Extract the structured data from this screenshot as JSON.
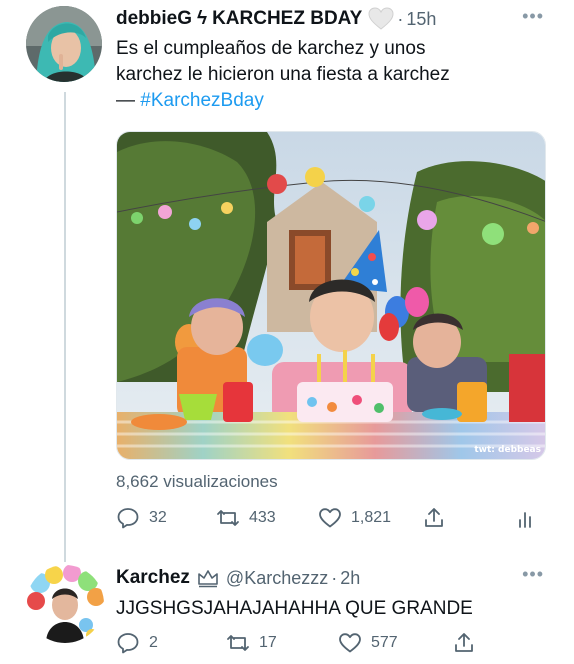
{
  "tweet": {
    "author_name": "debbieG",
    "author_bolt": "ϟ",
    "author_title": "KARCHEZ BDAY",
    "badge_icon": "white-heart-icon",
    "dot": "·",
    "time": "15h",
    "text_line1": "Es el cumpleaños de karchez y unos",
    "text_line2": "karchez le hicieron una fiesta a karchez",
    "text_prefix": "— ",
    "hashtag": "#KarchezBday",
    "media_watermark": "twt: debbeas",
    "views": "8,662 visualizaciones",
    "replies": "32",
    "retweets": "433",
    "likes": "1,821"
  },
  "reply": {
    "author_name": "Karchez",
    "badge_icon": "crown-icon",
    "handle": "@Karchezzz",
    "dot": "·",
    "time": "2h",
    "text": "JJGSHGSJAHAJAHAHHA QUE GRANDE",
    "replies": "2",
    "retweets": "17",
    "likes": "577"
  },
  "more_label": "•••",
  "colors": {
    "accent": "#1d9bf0",
    "secondary": "#536471",
    "line": "#cfd9de"
  }
}
